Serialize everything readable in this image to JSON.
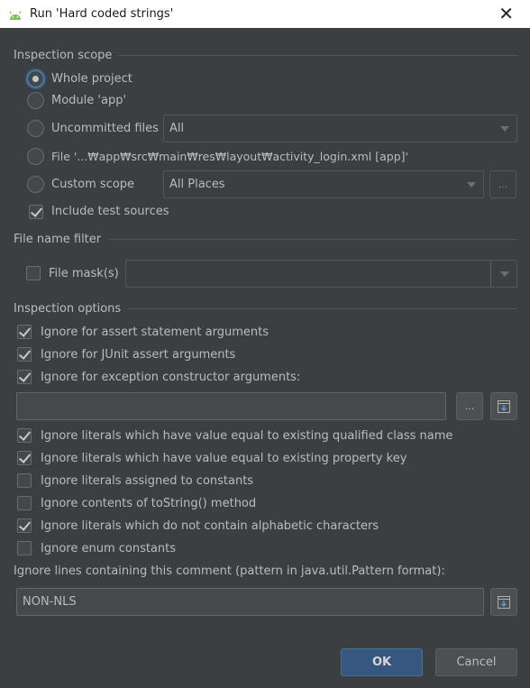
{
  "window": {
    "title": "Run 'Hard coded strings'",
    "close_glyph": "✕"
  },
  "inspection_scope": {
    "header": "Inspection scope",
    "options": [
      {
        "label": "Whole project",
        "checked": true
      },
      {
        "label": "Module 'app'",
        "checked": false
      },
      {
        "label": "Uncommitted files",
        "checked": false,
        "combo_value": "All"
      },
      {
        "label": "File '...₩app₩src₩main₩res₩layout₩activity_login.xml [app]'",
        "checked": false
      },
      {
        "label": "Custom scope",
        "checked": false,
        "combo_value": "All Places",
        "button": "..."
      }
    ],
    "include_test_sources": {
      "label": "Include test sources",
      "checked": true
    }
  },
  "file_name_filter": {
    "header": "File name filter",
    "file_mask": {
      "label": "File mask(s)",
      "checked": false,
      "value": ""
    }
  },
  "inspection_options": {
    "header": "Inspection options",
    "group1": [
      {
        "label": "Ignore for assert statement arguments",
        "checked": true
      },
      {
        "label": "Ignore for JUnit assert arguments",
        "checked": true
      },
      {
        "label": "Ignore for exception constructor arguments:",
        "checked": true
      }
    ],
    "exception_field": {
      "value": "",
      "browse_button": "..."
    },
    "group2": [
      {
        "label": "Ignore literals which have value equal to existing qualified class name",
        "checked": true
      },
      {
        "label": "Ignore literals which have value equal to existing property key",
        "checked": true
      },
      {
        "label": "Ignore literals assigned to constants",
        "checked": false
      },
      {
        "label": "Ignore contents of toString() method",
        "checked": false
      },
      {
        "label": "Ignore literals which do not contain alphabetic characters",
        "checked": true
      },
      {
        "label": "Ignore enum constants",
        "checked": false
      }
    ],
    "comment_label": "Ignore lines containing this comment (pattern in java.util.Pattern format):",
    "comment_value": "NON-NLS"
  },
  "buttons": {
    "ok": "OK",
    "cancel": "Cancel"
  },
  "colors": {
    "background": "#3c3f41",
    "accent": "#365880",
    "text": "#bbbbbb"
  }
}
